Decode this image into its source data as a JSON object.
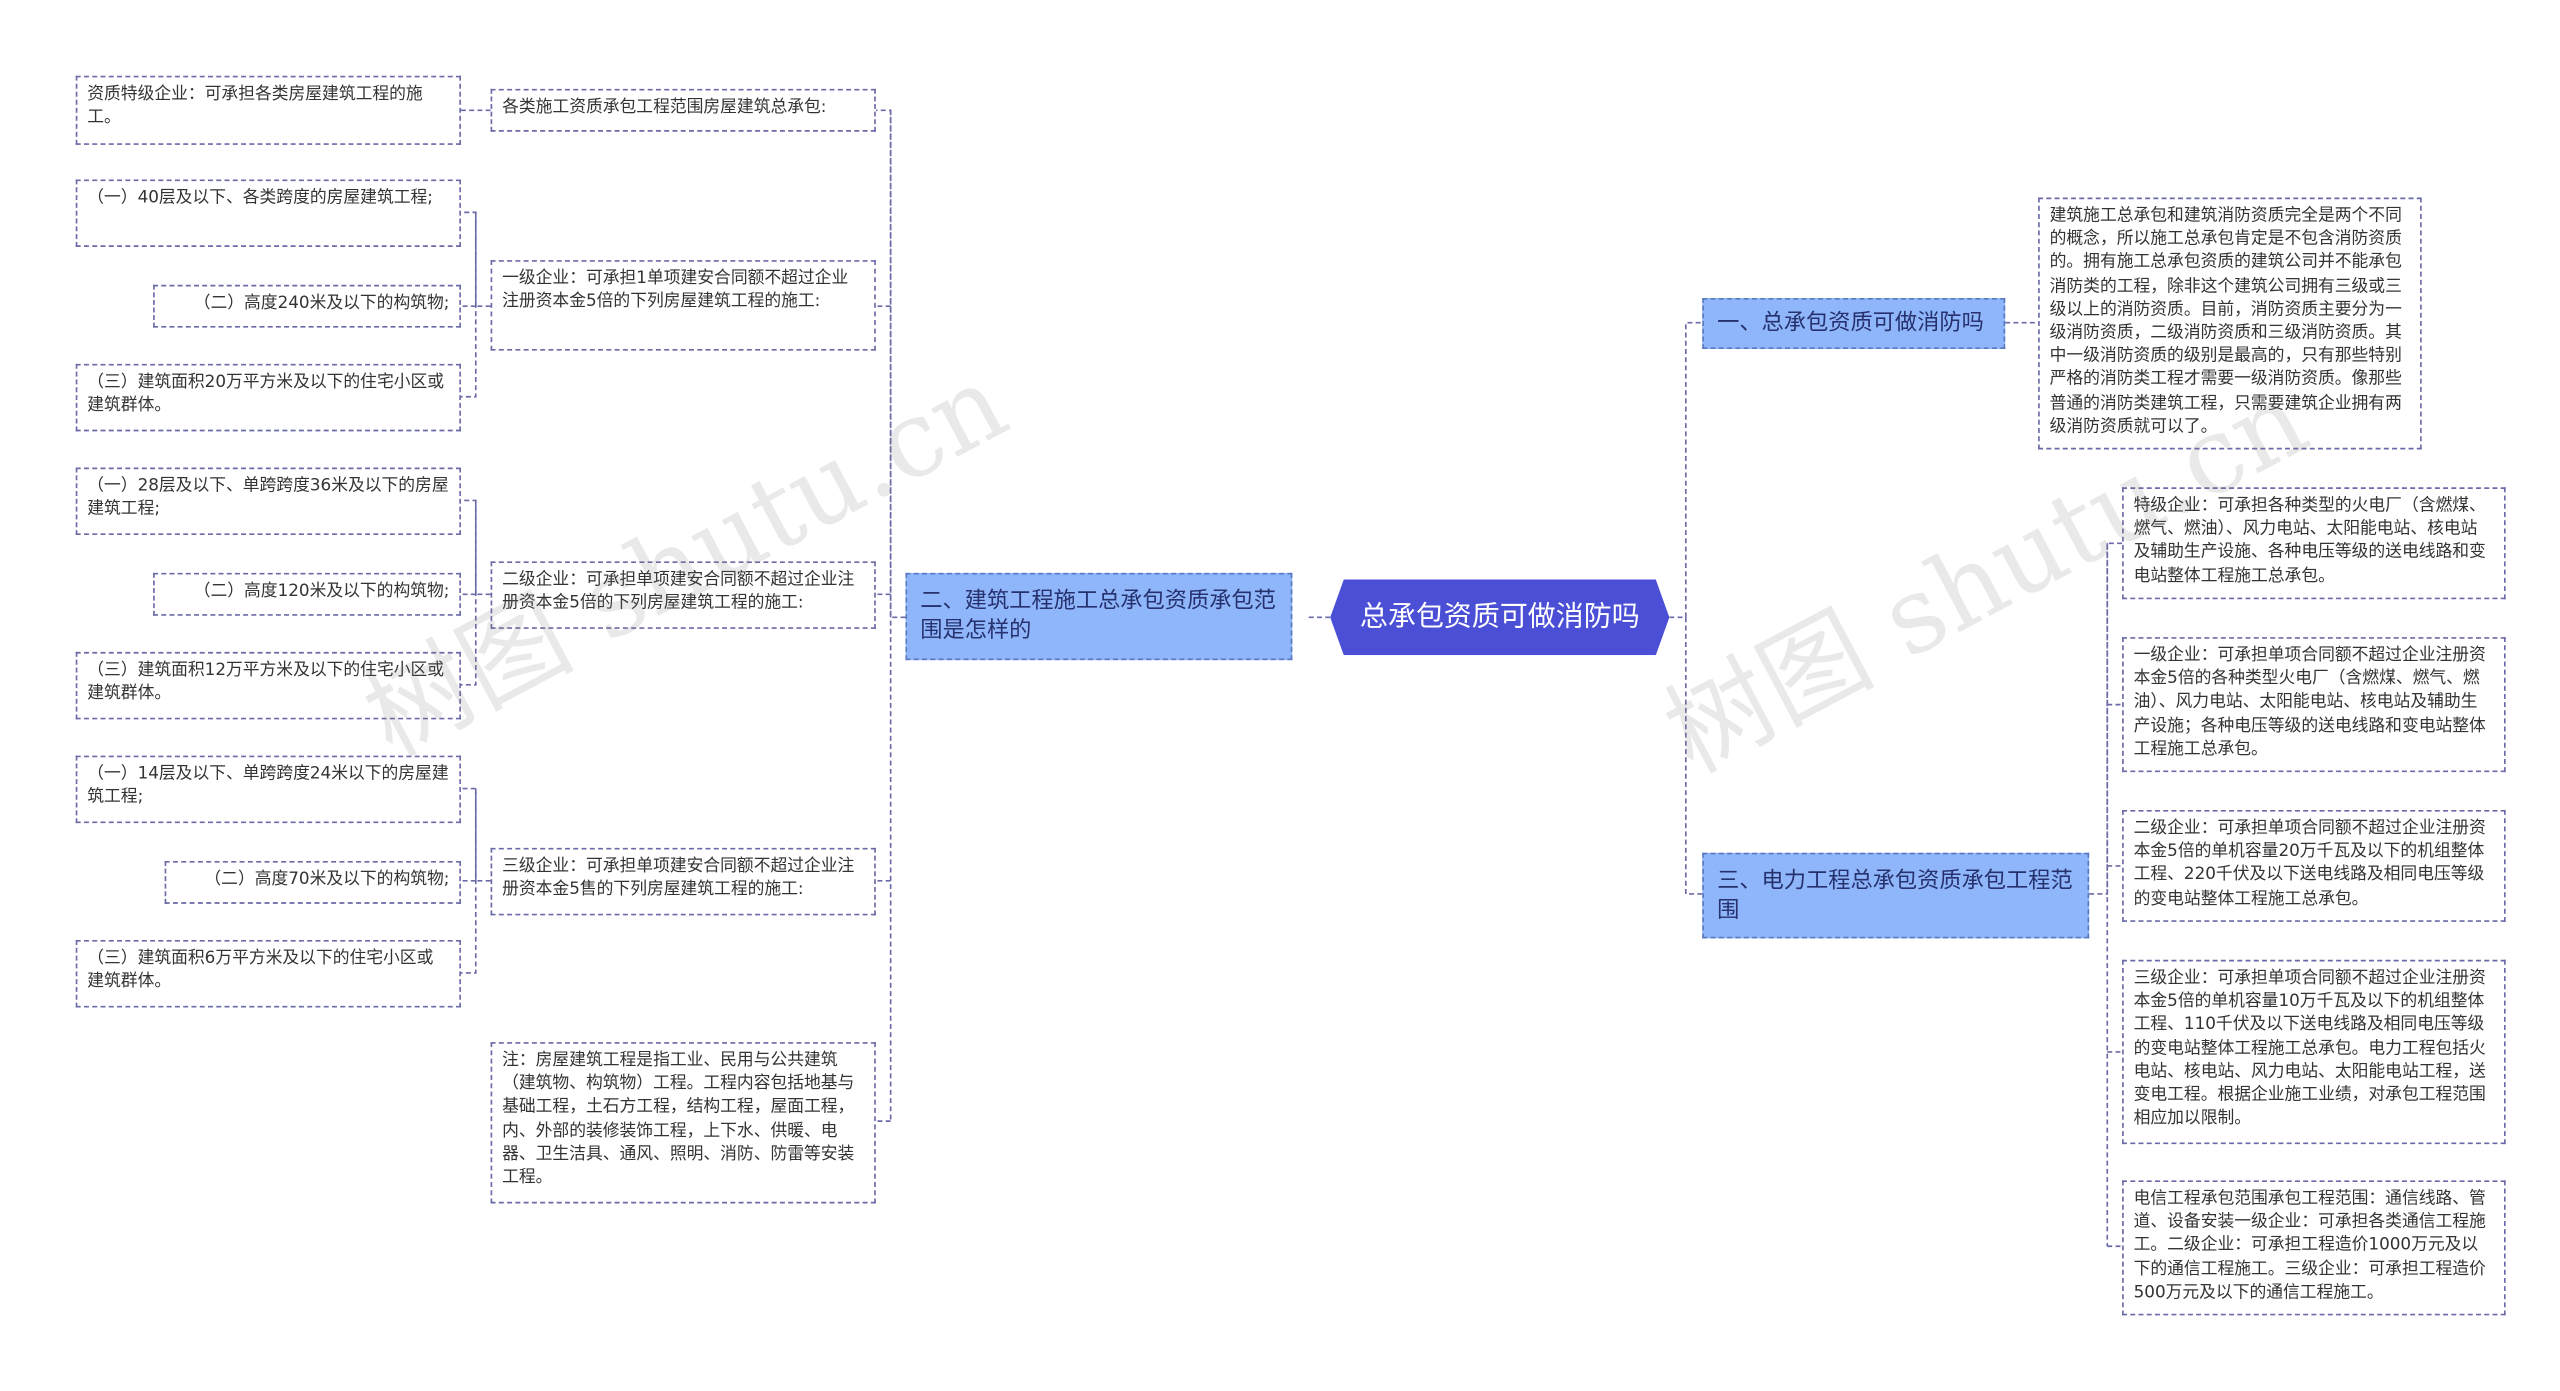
{
  "root": {
    "label": "总承包资质可做消防吗"
  },
  "watermark": "树图 shutu.cn",
  "branches": {
    "left": {
      "label": "二、建筑工程施工总承包资质承包范围是怎样的",
      "n1": {
        "label": "各类施工资质承包工程范围房屋建筑总承包:",
        "c1": "资质特级企业：可承担各类房屋建筑工程的施工。"
      },
      "n2": {
        "label": "一级企业：可承担1单项建安合同额不超过企业注册资本金5倍的下列房屋建筑工程的施工:",
        "c1": "（一）40层及以下、各类跨度的房屋建筑工程;",
        "c2": "（二）高度240米及以下的构筑物;",
        "c3": "（三）建筑面积20万平方米及以下的住宅小区或建筑群体。"
      },
      "n3": {
        "label": "二级企业：可承担单项建安合同额不超过企业注册资本金5倍的下列房屋建筑工程的施工:",
        "c1": "（一）28层及以下、单跨跨度36米及以下的房屋建筑工程;",
        "c2": "（二）高度120米及以下的构筑物;",
        "c3": "（三）建筑面积12万平方米及以下的住宅小区或建筑群体。"
      },
      "n4": {
        "label": "三级企业：可承担单项建安合同额不超过企业注册资本金5售的下列房屋建筑工程的施工:",
        "c1": "（一）14层及以下、单跨跨度24米以下的房屋建筑工程;",
        "c2": "（二）高度70米及以下的构筑物;",
        "c3": "（三）建筑面积6万平方米及以下的住宅小区或建筑群体。"
      },
      "n5": {
        "label": "注：房屋建筑工程是指工业、民用与公共建筑（建筑物、构筑物）工程。工程内容包括地基与基础工程，土石方工程，结构工程，屋面工程，内、外部的装修装饰工程，上下水、供暖、电器、卫生洁具、通风、照明、消防、防雷等安装工程。"
      }
    },
    "right1": {
      "label": "一、总承包资质可做消防吗",
      "c1": "建筑施工总承包和建筑消防资质完全是两个不同的概念，所以施工总承包肯定是不包含消防资质的。拥有施工总承包资质的建筑公司并不能承包消防类的工程，除非这个建筑公司拥有三级或三级以上的消防资质。目前，消防资质主要分为一级消防资质，二级消防资质和三级消防资质。其中一级消防资质的级别是最高的，只有那些特别严格的消防类工程才需要一级消防资质。像那些普通的消防类建筑工程，只需要建筑企业拥有两级消防资质就可以了。"
    },
    "right2": {
      "label": "三、电力工程总承包资质承包工程范围",
      "c1": "特级企业：可承担各种类型的火电厂（含燃煤、燃气、燃油）、风力电站、太阳能电站、核电站及辅助生产设施、各种电压等级的送电线路和变电站整体工程施工总承包。",
      "c2": "一级企业：可承担单项合同额不超过企业注册资本金5倍的各种类型火电厂（含燃煤、燃气、燃油）、风力电站、太阳能电站、核电站及辅助生产设施；各种电压等级的送电线路和变电站整体工程施工总承包。",
      "c3": "二级企业：可承担单项合同额不超过企业注册资本金5倍的单机容量20万千瓦及以下的机组整体工程、220千伏及以下送电线路及相同电压等级的变电站整体工程施工总承包。",
      "c4": "三级企业：可承担单项合同额不超过企业注册资本金5倍的单机容量10万千瓦及以下的机组整体工程、110千伏及以下送电线路及相同电压等级的变电站整体工程施工总承包。电力工程包括火电站、核电站、风力电站、太阳能电站工程，送变电工程。根据企业施工业绩，对承包工程范围相应加以限制。",
      "c5": "电信工程承包范围承包工程范围：通信线路、管道、设备安装一级企业：可承担各类通信工程施工。二级企业：可承担工程造价1000万元及以下的通信工程施工。三级企业：可承担工程造价500万元及以下的通信工程施工。"
    }
  },
  "colors": {
    "root": "#4b4fd6",
    "branch": "#8fb6fb",
    "line": "#6a6aa8"
  }
}
